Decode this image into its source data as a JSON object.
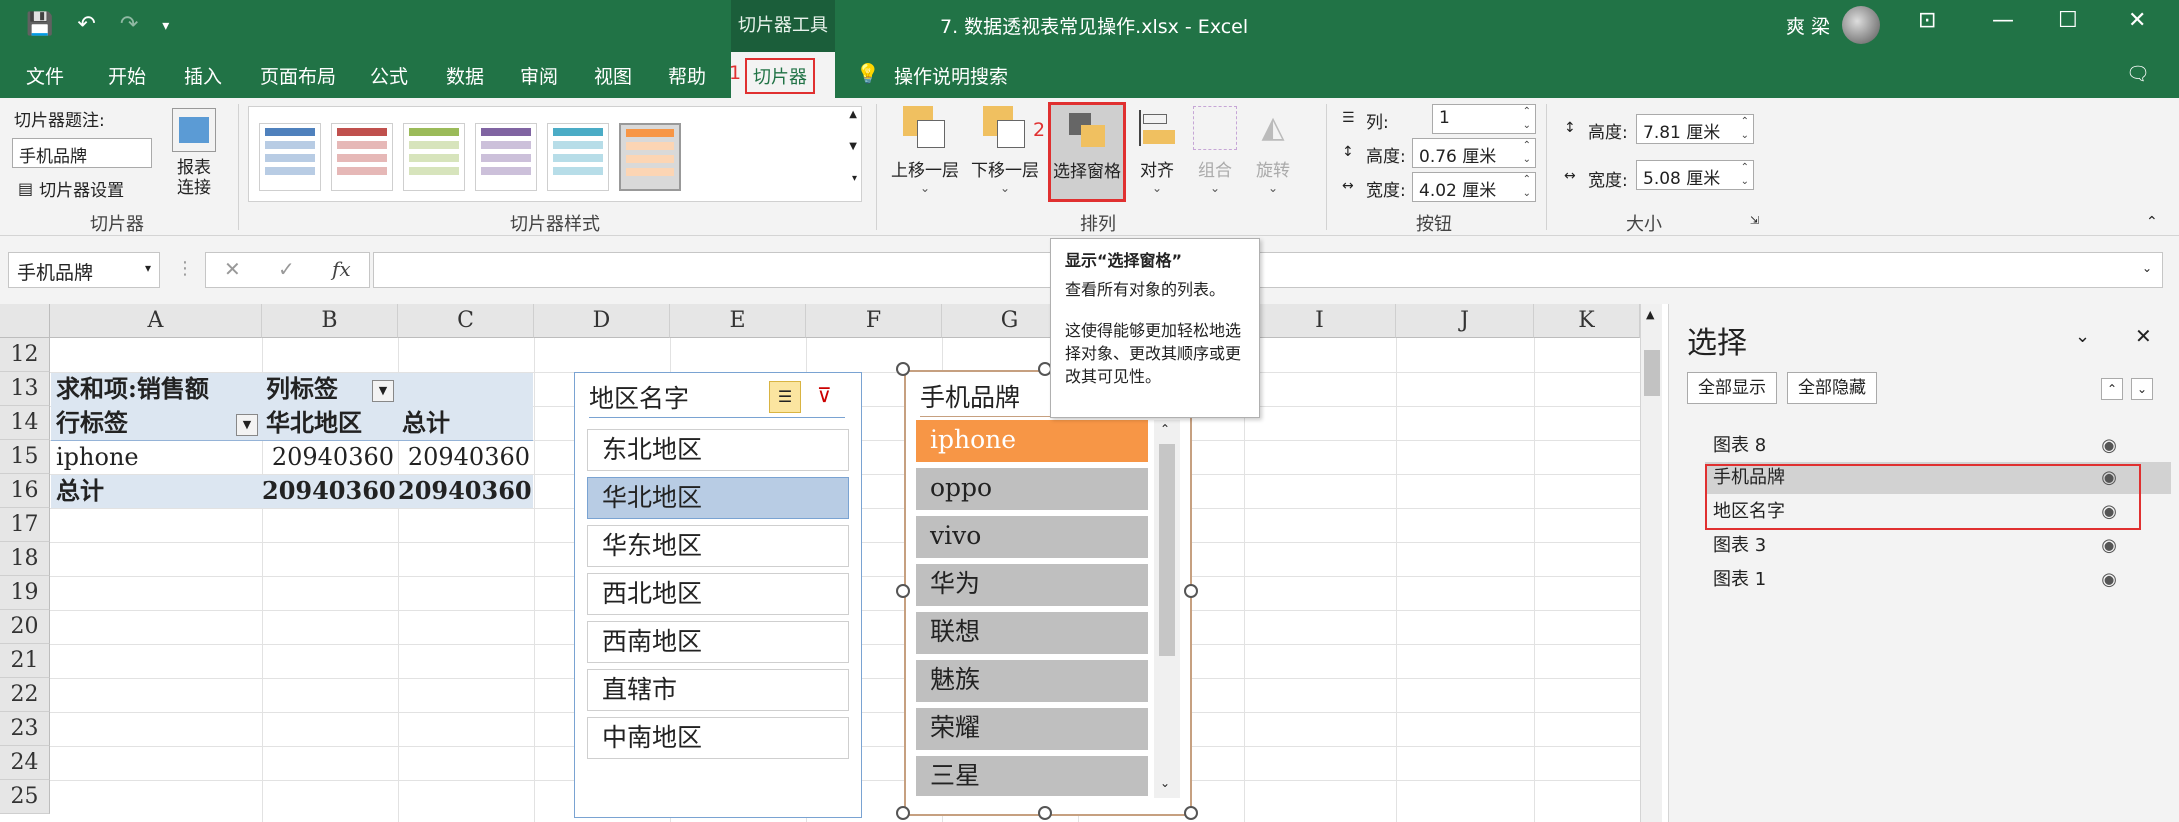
{
  "titlebar": {
    "context_tools": "切片器工具",
    "doc_title": "7. 数据透视表常见操作.xlsx  -  Excel",
    "user_name": "爽 梁"
  },
  "tabs": {
    "items": [
      "文件",
      "开始",
      "插入",
      "页面布局",
      "公式",
      "数据",
      "审阅",
      "视图",
      "帮助"
    ],
    "slicer_num": "1",
    "slicer_tab": "切片器",
    "tell_me": "操作说明搜索"
  },
  "ribbon": {
    "caption_label": "切片器题注:",
    "caption_value": "手机品牌",
    "slicer_settings": "切片器设置",
    "report_connect": "报表连接",
    "group_slicer": "切片器",
    "group_styles": "切片器样式",
    "bring_forward": "上移一层",
    "send_backward": "下移一层",
    "selection_pane_num": "2",
    "selection_pane": "选择窗格",
    "align": "对齐",
    "group": "组合",
    "rotate": "旋转",
    "group_arrange": "排列",
    "columns_label": "列:",
    "columns_value": "1",
    "btn_height_label": "高度:",
    "btn_height_value": "0.76 厘米",
    "btn_width_label": "宽度:",
    "btn_width_value": "4.02 厘米",
    "group_buttons": "按钮",
    "height_label": "高度:",
    "height_value": "7.81 厘米",
    "width_label": "宽度:",
    "width_value": "5.08 厘米",
    "group_size": "大小"
  },
  "formula_bar": {
    "name_box": "手机品牌",
    "fx": "fx"
  },
  "grid": {
    "columns": [
      "A",
      "B",
      "C",
      "D",
      "E",
      "F",
      "G",
      "H",
      "I",
      "J",
      "K"
    ],
    "rows": [
      "12",
      "13",
      "14",
      "15",
      "16",
      "17",
      "18",
      "19",
      "20",
      "21",
      "22",
      "23",
      "24",
      "25"
    ],
    "pivot": {
      "sum_label": "求和项:销售额",
      "col_label": "列标签",
      "row_label": "行标签",
      "col_north": "华北地区",
      "col_total": "总计",
      "row1_name": "iphone",
      "row1_b": "20940360",
      "row1_c": "20940360",
      "total_name": "总计",
      "total_b": "20940360",
      "total_c": "20940360"
    }
  },
  "slicer_region": {
    "title": "地区名字",
    "items": [
      "东北地区",
      "华北地区",
      "华东地区",
      "西北地区",
      "西南地区",
      "直辖市",
      "中南地区"
    ],
    "selected": "华北地区"
  },
  "slicer_brand": {
    "title": "手机品牌",
    "items": [
      "iphone",
      "oppo",
      "vivo",
      "华为",
      "联想",
      "魅族",
      "荣耀",
      "三星"
    ],
    "selected": "iphone"
  },
  "tooltip": {
    "title": "显示“选择窗格”",
    "line1": "查看所有对象的列表。",
    "line2": "这使得能够更加轻松地选择对象、更改其顺序或更改其可见性。"
  },
  "selection_pane": {
    "title": "选择",
    "show_all": "全部显示",
    "hide_all": "全部隐藏",
    "objects": [
      "图表 8",
      "手机品牌",
      "地区名字",
      "图表 3",
      "图表 1"
    ]
  },
  "colors": {
    "excel_green": "#217346",
    "pivot_blue": "#dce6f1",
    "slicer_orange": "#f79646",
    "slicer_gray": "#bfbfbf",
    "region_selected": "#b8cce4",
    "highlight_red": "#e03030"
  }
}
